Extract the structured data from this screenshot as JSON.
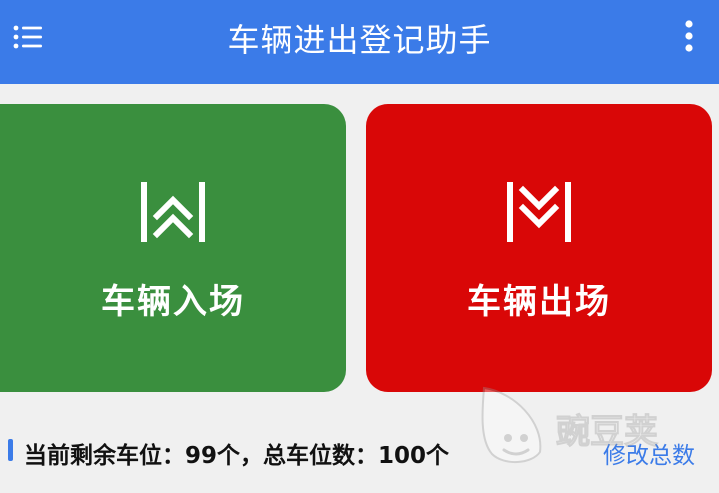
{
  "header": {
    "title": "车辆进出登记助手",
    "menu_icon": "hamburger-list-icon",
    "more_icon": "vertical-dots-icon",
    "background_color": "#3b7be8"
  },
  "actions": {
    "entry": {
      "label": "车辆入场",
      "icon": "double-chevron-up-icon",
      "color": "#3a8f3e"
    },
    "exit": {
      "label": "车辆出场",
      "icon": "double-chevron-down-icon",
      "color": "#d90707"
    }
  },
  "status": {
    "text": "当前剩余车位：99个，总车位数：100个",
    "remaining_spots": 99,
    "total_spots": 100,
    "edit_total_label": "修改总数"
  },
  "watermark": {
    "text": "豌豆荚",
    "logo_icon": "pea-pod-logo-icon"
  }
}
